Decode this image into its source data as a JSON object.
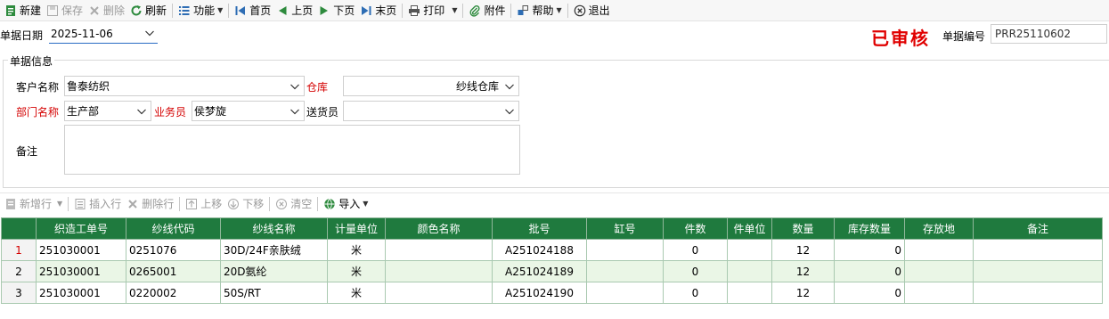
{
  "toolbar": {
    "items": [
      {
        "label": "新建",
        "icon": "new-doc-icon"
      },
      {
        "label": "保存",
        "icon": "save-icon"
      },
      {
        "label": "删除",
        "icon": "delete-icon"
      },
      {
        "label": "刷新",
        "icon": "refresh-icon"
      },
      {
        "label": "功能",
        "icon": "function-menu-icon"
      },
      {
        "label": "首页",
        "icon": "first-page-icon"
      },
      {
        "label": "上页",
        "icon": "prev-page-icon"
      },
      {
        "label": "下页",
        "icon": "next-page-icon"
      },
      {
        "label": "末页",
        "icon": "last-page-icon"
      },
      {
        "label": "打印",
        "icon": "print-icon"
      },
      {
        "label": "附件",
        "icon": "attachment-icon"
      },
      {
        "label": "帮助",
        "icon": "help-icon"
      },
      {
        "label": "退出",
        "icon": "exit-icon"
      }
    ]
  },
  "header": {
    "date_label": "单据日期",
    "date_value": "2025-11-06",
    "status_stamp": "已审核",
    "docno_label": "单据编号",
    "docno_value": "PRR25110602"
  },
  "form": {
    "group_title": "单据信息",
    "customer_label": "客户名称",
    "customer_value": "鲁泰纺织",
    "warehouse_label": "仓库",
    "warehouse_value": "纱线仓库",
    "dept_label": "部门名称",
    "dept_value": "生产部",
    "salesman_label": "业务员",
    "salesman_value": "侯梦旋",
    "delivery_label": "送货员",
    "delivery_value": "",
    "remark_label": "备注",
    "remark_value": ""
  },
  "grid_toolbar": {
    "add_row": "新增行",
    "insert_row": "插入行",
    "delete_row": "删除行",
    "move_up": "上移",
    "move_down": "下移",
    "clear": "清空",
    "import": "导入"
  },
  "table": {
    "columns": [
      "织造工单号",
      "纱线代码",
      "纱线名称",
      "计量单位",
      "颜色名称",
      "批号",
      "缸号",
      "件数",
      "件单位",
      "数量",
      "库存数量",
      "存放地",
      "备注"
    ],
    "rows": [
      {
        "no": "1",
        "order": "251030001",
        "code": "0251076",
        "name": "30D/24F亲肤绒",
        "unit": "米",
        "color": "",
        "batch": "A251024188",
        "vat": "",
        "pieces": "0",
        "piece_unit": "",
        "qty": "12",
        "stock": "0",
        "place": "",
        "remark": ""
      },
      {
        "no": "2",
        "order": "251030001",
        "code": "0265001",
        "name": "20D氨纶",
        "unit": "米",
        "color": "",
        "batch": "A251024189",
        "vat": "",
        "pieces": "0",
        "piece_unit": "",
        "qty": "12",
        "stock": "0",
        "place": "",
        "remark": ""
      },
      {
        "no": "3",
        "order": "251030001",
        "code": "0220002",
        "name": "50S/RT",
        "unit": "米",
        "color": "",
        "batch": "A251024190",
        "vat": "",
        "pieces": "0",
        "piece_unit": "",
        "qty": "12",
        "stock": "0",
        "place": "",
        "remark": ""
      }
    ]
  }
}
